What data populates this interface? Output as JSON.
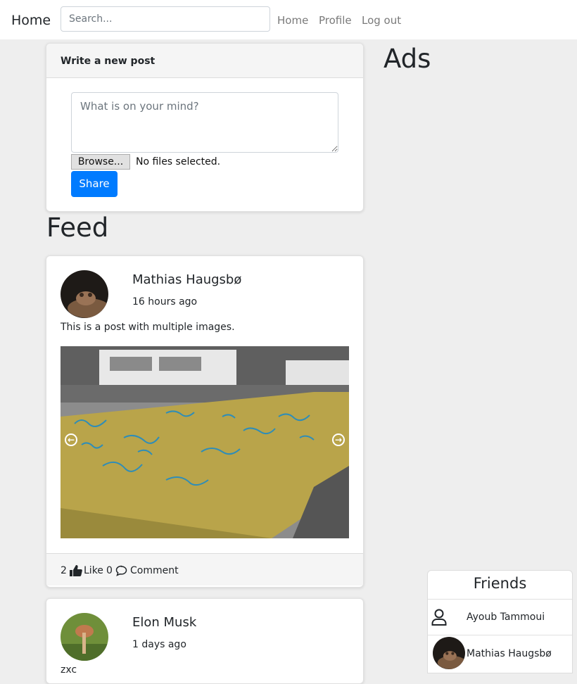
{
  "navbar": {
    "brand": "Home",
    "search_placeholder": "Search...",
    "links": [
      "Home",
      "Profile",
      "Log out"
    ]
  },
  "write_post": {
    "title": "Write a new post",
    "placeholder": "What is on your mind?",
    "browse_label": "Browse...",
    "no_files": "No files selected.",
    "share_label": "Share"
  },
  "feed_heading": "Feed",
  "ads_heading": "Ads",
  "posts": [
    {
      "author": "Mathias Haugsbø",
      "time": "16 hours ago",
      "text": "This is a post with multiple images.",
      "likes": "2",
      "like_label": "Like",
      "comments": "0",
      "comment_label": "Comment"
    },
    {
      "author": "Elon Musk",
      "time": "1 days ago",
      "text": "zxc"
    }
  ],
  "friends": {
    "title": "Friends",
    "items": [
      "Ayoub Tammoui",
      "Mathias Haugsbø"
    ]
  },
  "colors": {
    "primary": "#007bff",
    "background": "#eeeeee"
  }
}
